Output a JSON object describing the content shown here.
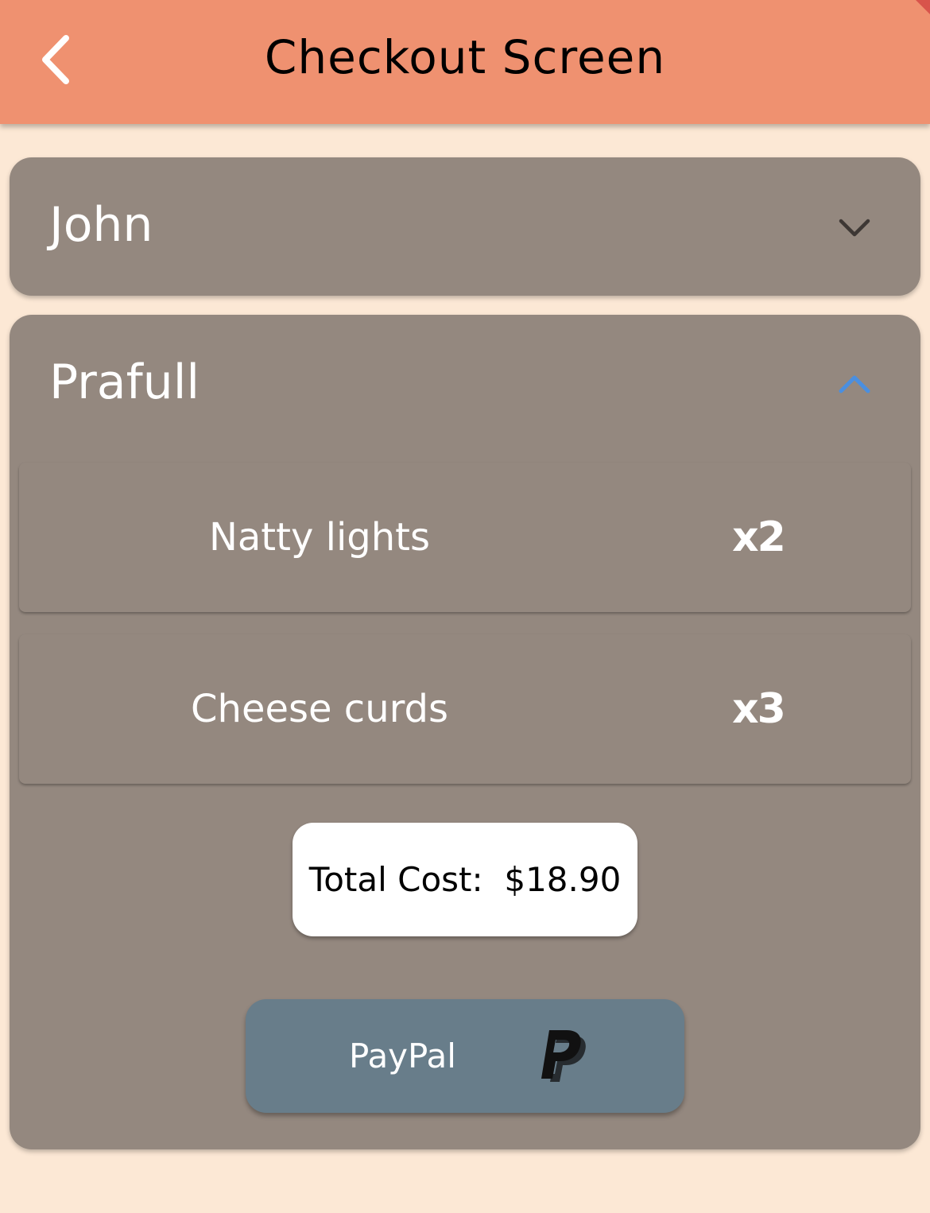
{
  "appbar": {
    "title": "Checkout Screen",
    "back_icon": "chevron-left-icon",
    "color": "#ef9170"
  },
  "theme": {
    "background": "#fce8d5",
    "card": "#94887f",
    "paypal_button": "#687d8a",
    "accent": "#4a8fe0"
  },
  "people": [
    {
      "name": "John",
      "expanded": false,
      "toggle_icon": "chevron-down-icon"
    },
    {
      "name": "Prafull",
      "expanded": true,
      "toggle_icon": "chevron-up-icon",
      "items": [
        {
          "name": "Natty lights",
          "qty": "x2"
        },
        {
          "name": "Cheese curds",
          "qty": "x3"
        }
      ],
      "total": "Total Cost:  $18.90",
      "payment": {
        "label": "PayPal",
        "icon": "paypal-icon"
      }
    }
  ]
}
